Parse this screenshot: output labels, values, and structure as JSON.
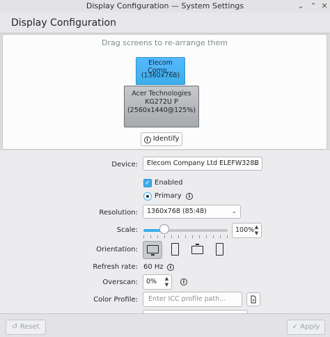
{
  "window": {
    "title": "Display Configuration — System Settings"
  },
  "header": {
    "title": "Display Configuration"
  },
  "arrangement": {
    "hint": "Drag screens to re-arrange them",
    "screens": [
      {
        "name": "Elecom Comp...",
        "mode": "(1360x768)",
        "selected": true
      },
      {
        "name_line1": "Acer Technologies",
        "name_line2": "KG272U P",
        "mode": "(2560x1440@125%)",
        "selected": false
      }
    ],
    "identify_label": "Identify",
    "info_glyph": "i"
  },
  "form": {
    "device_label": "Device:",
    "device_value": "Elecom Company Ltd ELEFW328B",
    "enabled_label": "Enabled",
    "enabled_checked": true,
    "primary_label": "Primary",
    "primary_checked": true,
    "resolution_label": "Resolution:",
    "resolution_value": "1360x768 (85:48)",
    "scale_label": "Scale:",
    "scale_value": "100%",
    "scale_fraction": 0.25,
    "orientation_label": "Orientation:",
    "refresh_label": "Refresh rate:",
    "refresh_value": "60 Hz",
    "overscan_label": "Overscan:",
    "overscan_value": "0%",
    "color_profile_label": "Color Profile:",
    "color_profile_placeholder": "Enter ICC profile path..."
  },
  "footer": {
    "reset_label": "Reset",
    "apply_label": "Apply"
  },
  "colors": {
    "accent": "#3daee9",
    "window_bg": "#ececee",
    "panel_bg": "#fcfcfc"
  }
}
